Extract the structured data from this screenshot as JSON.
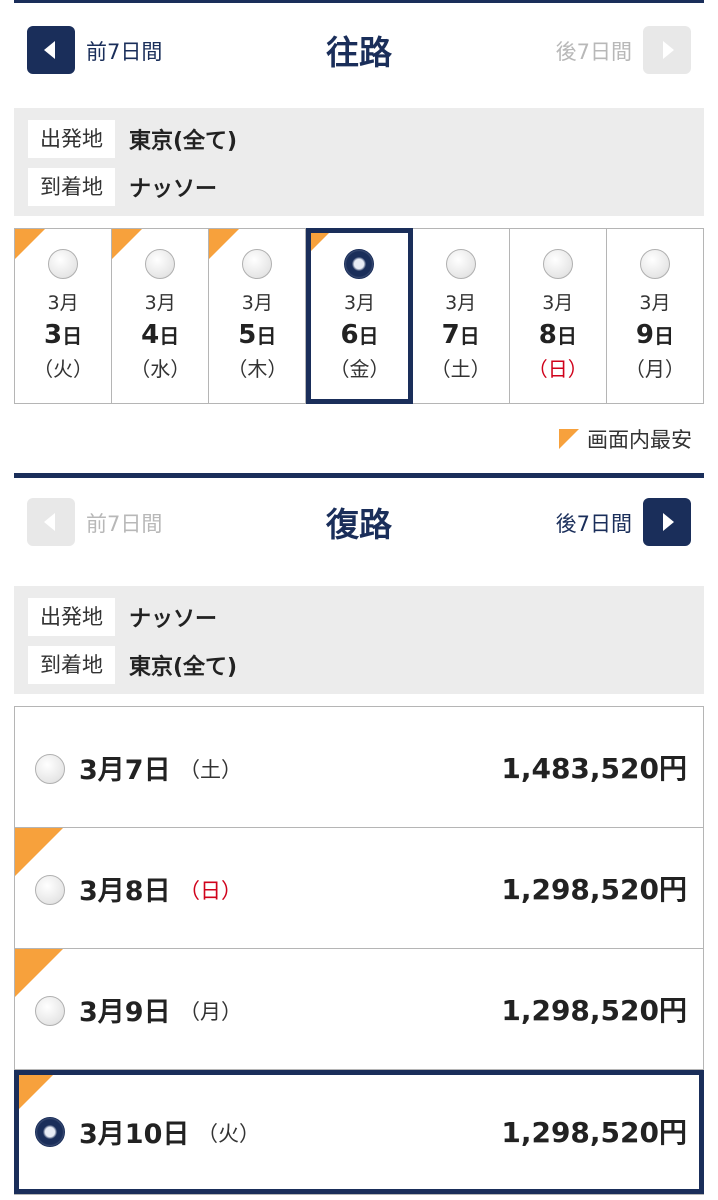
{
  "outbound": {
    "prev_label": "前7日間",
    "title": "往路",
    "next_label": "後7日間",
    "route": {
      "origin_key": "出発地",
      "origin_val": "東京(全て)",
      "dest_key": "到着地",
      "dest_val": "ナッソー"
    },
    "day_unit": "日",
    "days": [
      {
        "month": "3月",
        "date": "3",
        "dow": "（火）",
        "cheapest": true,
        "selected": false,
        "sunday": false
      },
      {
        "month": "3月",
        "date": "4",
        "dow": "（水）",
        "cheapest": true,
        "selected": false,
        "sunday": false
      },
      {
        "month": "3月",
        "date": "5",
        "dow": "（木）",
        "cheapest": true,
        "selected": false,
        "sunday": false
      },
      {
        "month": "3月",
        "date": "6",
        "dow": "（金）",
        "cheapest": true,
        "selected": true,
        "sunday": false
      },
      {
        "month": "3月",
        "date": "7",
        "dow": "（土）",
        "cheapest": false,
        "selected": false,
        "sunday": false
      },
      {
        "month": "3月",
        "date": "8",
        "dow": "（日）",
        "cheapest": false,
        "selected": false,
        "sunday": true
      },
      {
        "month": "3月",
        "date": "9",
        "dow": "（月）",
        "cheapest": false,
        "selected": false,
        "sunday": false
      }
    ],
    "legend": "画面内最安"
  },
  "inbound": {
    "prev_label": "前7日間",
    "title": "復路",
    "next_label": "後7日間",
    "route": {
      "origin_key": "出発地",
      "origin_val": "ナッソー",
      "dest_key": "到着地",
      "dest_val": "東京(全て)"
    },
    "rows": [
      {
        "date": "3月7日",
        "dow": "（土）",
        "price": "1,483,520円",
        "cheapest": false,
        "selected": false,
        "sunday": false
      },
      {
        "date": "3月8日",
        "dow": "（日）",
        "price": "1,298,520円",
        "cheapest": true,
        "selected": false,
        "sunday": true
      },
      {
        "date": "3月9日",
        "dow": "（月）",
        "price": "1,298,520円",
        "cheapest": true,
        "selected": false,
        "sunday": false
      },
      {
        "date": "3月10日",
        "dow": "（火）",
        "price": "1,298,520円",
        "cheapest": true,
        "selected": true,
        "sunday": false
      }
    ]
  },
  "colors": {
    "navy": "#1a2e5a",
    "cheapest_flag": "#f7a13c",
    "sunday": "#d0021b",
    "route_bg": "#ececec"
  }
}
